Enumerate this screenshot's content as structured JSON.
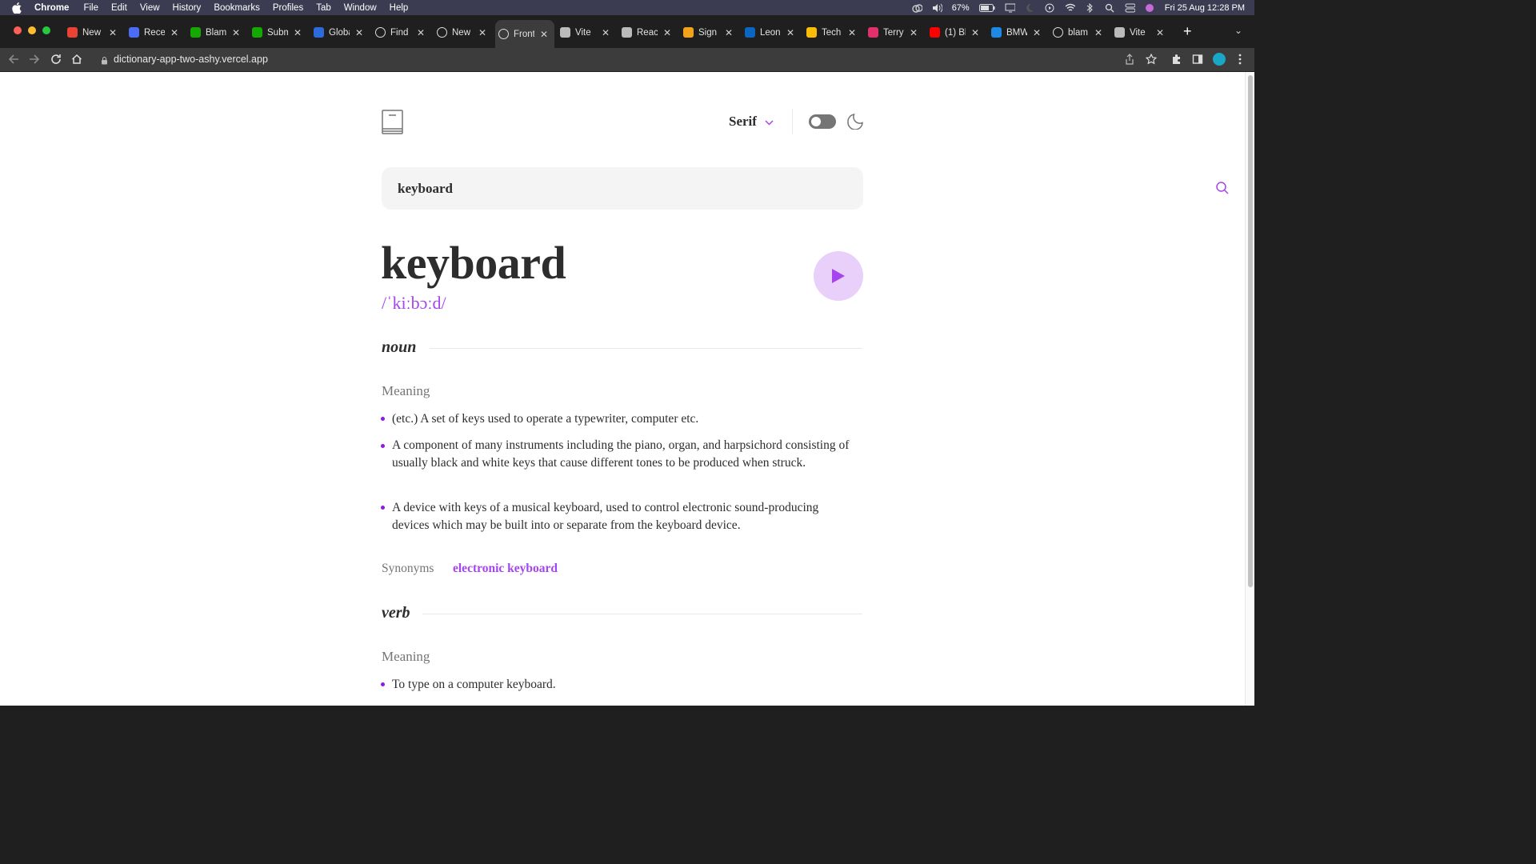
{
  "menubar": {
    "app": "Chrome",
    "items": [
      "File",
      "Edit",
      "View",
      "History",
      "Bookmarks",
      "Profiles",
      "Tab",
      "Window",
      "Help"
    ],
    "battery": "67%",
    "datetime": "Fri 25 Aug  12:28 PM"
  },
  "tabs": [
    {
      "title": "New",
      "favicon": "gmail-icon",
      "color": "#ea4335",
      "active": false
    },
    {
      "title": "Rece",
      "favicon": "blue-circle-icon",
      "color": "#4a6cf7",
      "active": false
    },
    {
      "title": "Blam",
      "favicon": "upwork-icon",
      "color": "#14a800",
      "active": false
    },
    {
      "title": "Subm",
      "favicon": "upwork-icon",
      "color": "#14a800",
      "active": false
    },
    {
      "title": "Globa",
      "favicon": "checkmark-icon",
      "color": "#2d6bdc",
      "active": false
    },
    {
      "title": "Find",
      "favicon": "document-icon",
      "color": "#ffffff",
      "active": false
    },
    {
      "title": "New",
      "favicon": "triangle-icon",
      "color": "#ffffff",
      "active": false
    },
    {
      "title": "Front",
      "favicon": "circle-icon",
      "color": "#ffffff",
      "active": true
    },
    {
      "title": "Vite",
      "favicon": "globe-icon",
      "color": "#bbbbbb",
      "active": false
    },
    {
      "title": "React",
      "favicon": "globe-icon",
      "color": "#bbbbbb",
      "active": false
    },
    {
      "title": "Sign",
      "favicon": "layers-icon",
      "color": "#f2a31b",
      "active": false
    },
    {
      "title": "Leon",
      "favicon": "linkedin-icon",
      "color": "#0a66c2",
      "active": false
    },
    {
      "title": "Tech",
      "favicon": "google-icon",
      "color": "#fbbc05",
      "active": false
    },
    {
      "title": "Terry",
      "favicon": "instagram-icon",
      "color": "#e1306c",
      "active": false
    },
    {
      "title": "(1) Bl",
      "favicon": "youtube-icon",
      "color": "#ff0000",
      "active": false
    },
    {
      "title": "BMW",
      "favicon": "cloud-icon",
      "color": "#1e88e5",
      "active": false
    },
    {
      "title": "blam",
      "favicon": "github-icon",
      "color": "#ffffff",
      "active": false
    },
    {
      "title": "Vite",
      "favicon": "globe-icon",
      "color": "#bbbbbb",
      "active": false
    }
  ],
  "address": {
    "url": "dictionary-app-two-ashy.vercel.app"
  },
  "app": {
    "font_label": "Serif",
    "search_value": "keyboard",
    "word": "keyboard",
    "phonetic": "/ˈkiːbɔːd/",
    "accent": "#a445ed",
    "meanings": [
      {
        "part_of_speech": "noun",
        "heading": "Meaning",
        "definitions": [
          "(etc.) A set of keys used to operate a typewriter, computer etc.",
          "A component of many instruments including the piano, organ, and harpsichord consisting of usually black and white keys that cause different tones to be produced when struck.",
          "A device with keys of a musical keyboard, used to control electronic sound-producing devices which may be built into or separate from the keyboard device."
        ],
        "synonyms_label": "Synonyms",
        "synonyms": "electronic keyboard"
      },
      {
        "part_of_speech": "verb",
        "heading": "Meaning",
        "definitions": [
          "To type on a computer keyboard."
        ]
      }
    ]
  }
}
